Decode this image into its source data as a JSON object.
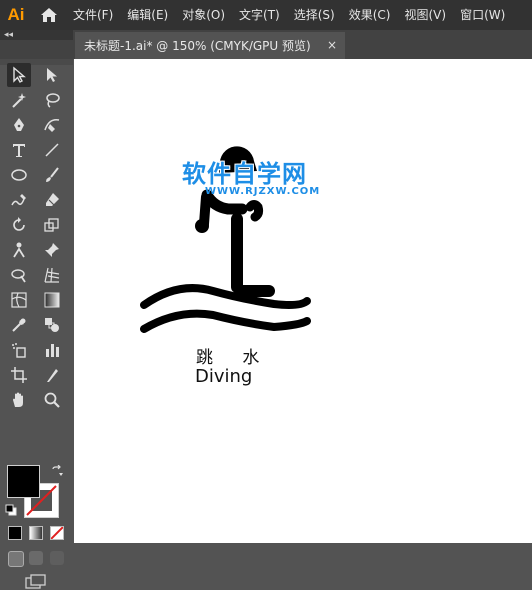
{
  "app": {
    "logo_text": "Ai"
  },
  "menu": [
    "文件(F)",
    "编辑(E)",
    "对象(O)",
    "文字(T)",
    "选择(S)",
    "效果(C)",
    "视图(V)",
    "窗口(W)"
  ],
  "tab": {
    "title": "未标题-1.ai* @ 150% (CMYK/GPU 预览)",
    "close": "×"
  },
  "panel": {
    "collapse": "◂◂"
  },
  "toolbar": {
    "tools": [
      "selection-tool",
      "direct-selection-tool",
      "magic-wand-tool",
      "lasso-tool",
      "pen-tool",
      "curvature-tool",
      "type-tool",
      "line-segment-tool",
      "ellipse-tool",
      "paintbrush-tool",
      "shaper-tool",
      "eraser-tool",
      "rotate-tool",
      "scale-tool",
      "puppet-warp-tool",
      "pin-tool",
      "free-transform-tool",
      "perspective-grid-tool",
      "mesh-tool",
      "gradient-tool",
      "eyedropper-tool",
      "blend-tool",
      "symbol-sprayer-tool",
      "column-graph-tool",
      "artboard-tool",
      "slice-tool",
      "hand-tool",
      "zoom-tool"
    ],
    "selected_tool": "selection-tool",
    "fill_color": "#000000",
    "stroke_color": "none"
  },
  "canvas": {
    "label_cn": "跳 水",
    "label_en": "Diving",
    "watermark_cn": "软件自学网",
    "watermark_url": "WWW.RJZXW.COM",
    "watermark_color": "#1e8ee6"
  }
}
